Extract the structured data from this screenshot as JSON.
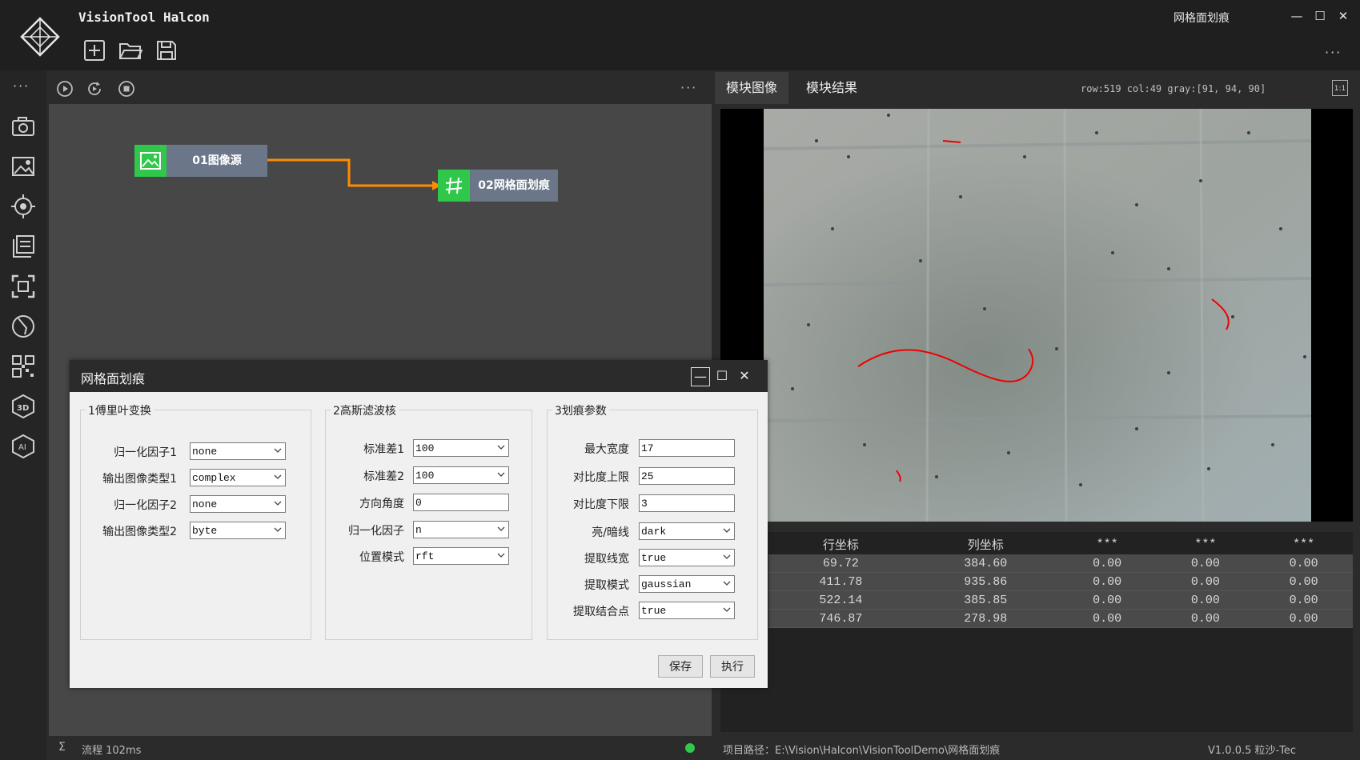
{
  "app": {
    "title": "VisionTool Halcon",
    "window_title": "网格面划痕"
  },
  "window_controls": {
    "minimize": "—",
    "maximize": "☐",
    "close": "✕"
  },
  "toolbar": {
    "more": "···"
  },
  "sidebar": {
    "more": "···"
  },
  "flow": {
    "more": "···",
    "nodes": [
      {
        "label": "01图像源",
        "icon": "image-icon"
      },
      {
        "label": "02网格面划痕",
        "icon": "grid-icon"
      }
    ],
    "status": {
      "symbol": "Σ",
      "text": "流程 102ms",
      "dot_color": "#2fc84a"
    }
  },
  "image_panel": {
    "tabs": [
      "模块图像",
      "模块结果"
    ],
    "coord_readout": "row:519 col:49 gray:[91, 94, 90]",
    "ratio_label": "1:1"
  },
  "results": {
    "columns": [
      "行坐标",
      "列坐标",
      "***",
      "***",
      "***"
    ],
    "rows": [
      [
        "69.72",
        "384.60",
        "0.00",
        "0.00",
        "0.00"
      ],
      [
        "411.78",
        "935.86",
        "0.00",
        "0.00",
        "0.00"
      ],
      [
        "522.14",
        "385.85",
        "0.00",
        "0.00",
        "0.00"
      ],
      [
        "746.87",
        "278.98",
        "0.00",
        "0.00",
        "0.00"
      ]
    ]
  },
  "status_right": {
    "path": "项目路径：E:\\Vision\\Halcon\\VisionToolDemo\\网格面划痕",
    "version": "V1.0.0.5 粒沙-Tec"
  },
  "dialog": {
    "title": "网格面划痕",
    "controls": {
      "minimize": "—",
      "maximize": "☐",
      "close": "✕"
    },
    "groups": [
      {
        "title": "1傅里叶变换",
        "fields": [
          {
            "label": "归一化因子1",
            "value": "none",
            "type": "select"
          },
          {
            "label": "输出图像类型1",
            "value": "complex",
            "type": "select"
          },
          {
            "label": "归一化因子2",
            "value": "none",
            "type": "select"
          },
          {
            "label": "输出图像类型2",
            "value": "byte",
            "type": "select"
          }
        ]
      },
      {
        "title": "2高斯滤波核",
        "fields": [
          {
            "label": "标准差1",
            "value": "100",
            "type": "select"
          },
          {
            "label": "标准差2",
            "value": "100",
            "type": "select"
          },
          {
            "label": "方向角度",
            "value": "0",
            "type": "input"
          },
          {
            "label": "归一化因子",
            "value": "n",
            "type": "select"
          },
          {
            "label": "位置模式",
            "value": "rft",
            "type": "select"
          }
        ]
      },
      {
        "title": "3划痕参数",
        "fields": [
          {
            "label": "最大宽度",
            "value": "17",
            "type": "input"
          },
          {
            "label": "对比度上限",
            "value": "25",
            "type": "input"
          },
          {
            "label": "对比度下限",
            "value": "3",
            "type": "input"
          },
          {
            "label": "亮/暗线",
            "value": "dark",
            "type": "select"
          },
          {
            "label": "提取线宽",
            "value": "true",
            "type": "select"
          },
          {
            "label": "提取模式",
            "value": "gaussian",
            "type": "select"
          },
          {
            "label": "提取结合点",
            "value": "true",
            "type": "select"
          }
        ]
      }
    ],
    "buttons": {
      "save": "保存",
      "run": "执行"
    }
  }
}
